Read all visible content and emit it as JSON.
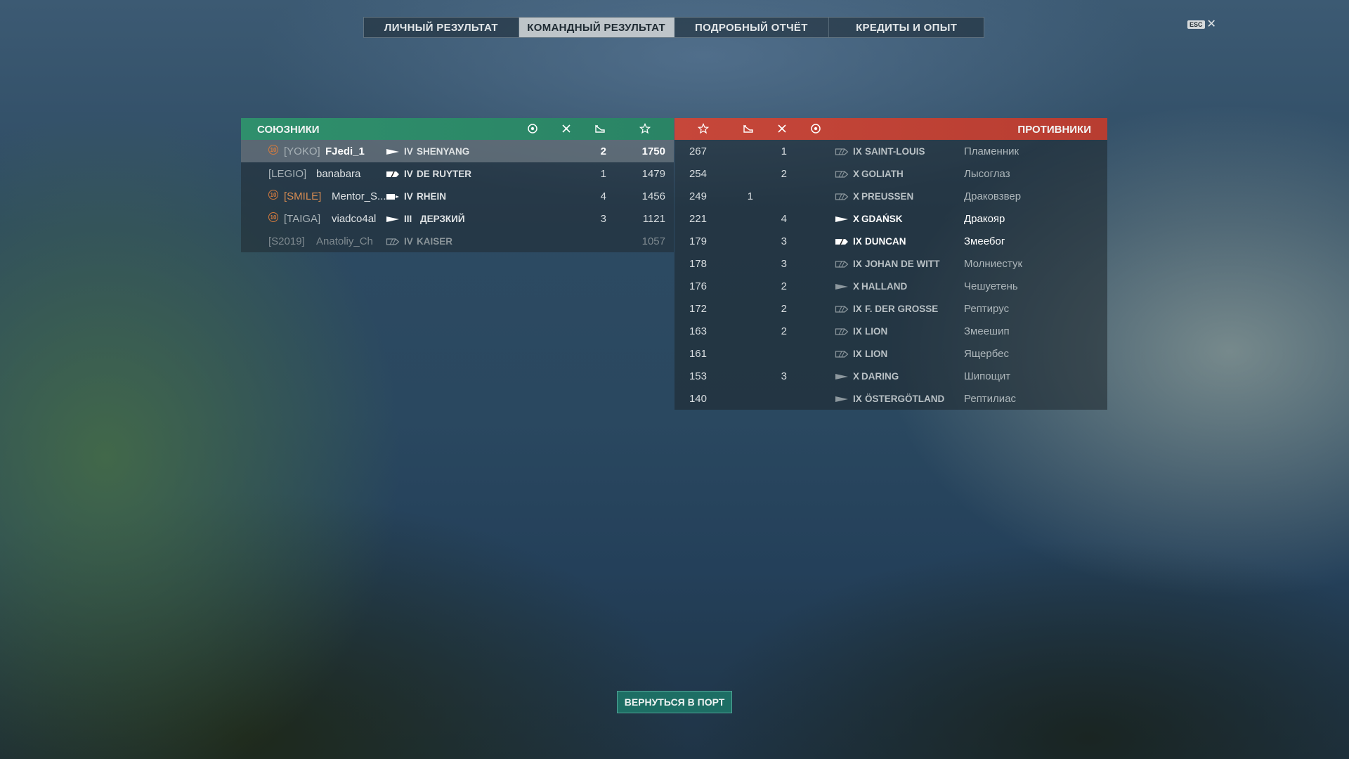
{
  "tabs": [
    "ЛИЧНЫЙ РЕЗУЛЬТАТ",
    "КОМАНДНЫЙ РЕЗУЛЬТАТ",
    "ПОДРОБНЫЙ ОТЧЁТ",
    "КРЕДИТЫ И ОПЫТ"
  ],
  "active_tab": 1,
  "esc_label": "ESC",
  "close_glyph": "✕",
  "allies": {
    "title": "СОЮЗНИКИ",
    "header_icons": [
      "achievement-icon",
      "frags-icon",
      "planes-icon",
      "star-icon"
    ],
    "rows": [
      {
        "badge": "10",
        "clan": "[YOKO]",
        "name": "FJedi_1",
        "tier": "IV",
        "ship": "SHENYANG",
        "ship_type": "destroyer",
        "kills": "2",
        "score": "1750",
        "highlight": true,
        "dim": false,
        "clan_color": "#a8b2b7"
      },
      {
        "badge": "",
        "clan": "[LEGIO]",
        "name": "banabara",
        "tier": "IV",
        "ship": "DE RUYTER",
        "ship_type": "cruiser",
        "kills": "1",
        "score": "1479",
        "highlight": false,
        "dim": false,
        "clan_color": "#a8b2b7"
      },
      {
        "badge": "10",
        "clan": "[SMILE]",
        "name": "Mentor_S...",
        "tier": "IV",
        "ship": "RHEIN",
        "ship_type": "carrier",
        "kills": "4",
        "score": "1456",
        "highlight": false,
        "dim": false,
        "clan_color": "#d98d52"
      },
      {
        "badge": "10",
        "clan": "[TAIGA]",
        "name": "viadco4al",
        "tier": "III",
        "ship": "ДЕРЗКИЙ",
        "ship_type": "destroyer",
        "kills": "3",
        "score": "1121",
        "highlight": false,
        "dim": false,
        "clan_color": "#a8b2b7"
      },
      {
        "badge": "",
        "clan": "[S2019]",
        "name": "Anatoliy_Ch",
        "tier": "IV",
        "ship": "KAISER",
        "ship_type": "battleship",
        "kills": "",
        "score": "1057",
        "highlight": false,
        "dim": true,
        "clan_color": "#7f8a90"
      }
    ]
  },
  "enemies": {
    "title": "ПРОТИВНИКИ",
    "header_icons": [
      "star-icon",
      "planes-icon",
      "frags-icon",
      "achievement-icon"
    ],
    "rows": [
      {
        "score": "267",
        "planes": "",
        "kills": "1",
        "tier": "IX",
        "ship": "SAINT-LOUIS",
        "ship_type": "battleship",
        "name": "Пламенник",
        "bright": false
      },
      {
        "score": "254",
        "planes": "",
        "kills": "2",
        "tier": "X",
        "ship": "GOLIATH",
        "ship_type": "battleship",
        "name": "Лысоглаз",
        "bright": false
      },
      {
        "score": "249",
        "planes": "1",
        "kills": "",
        "tier": "X",
        "ship": "PREUSSEN",
        "ship_type": "battleship",
        "name": "Драковзвер",
        "bright": false
      },
      {
        "score": "221",
        "planes": "",
        "kills": "4",
        "tier": "X",
        "ship": "GDAŃSK",
        "ship_type": "destroyer",
        "name": "Дракояр",
        "bright": true
      },
      {
        "score": "179",
        "planes": "",
        "kills": "3",
        "tier": "IX",
        "ship": "DUNCAN",
        "ship_type": "cruiser",
        "name": "Змеебог",
        "bright": true
      },
      {
        "score": "178",
        "planes": "",
        "kills": "3",
        "tier": "IX",
        "ship": "JOHAN DE WITT",
        "ship_type": "battleship",
        "name": "Молниестук",
        "bright": false
      },
      {
        "score": "176",
        "planes": "",
        "kills": "2",
        "tier": "X",
        "ship": "HALLAND",
        "ship_type": "destroyer",
        "name": "Чешуетень",
        "bright": false
      },
      {
        "score": "172",
        "planes": "",
        "kills": "2",
        "tier": "IX",
        "ship": "F. DER GROSSE",
        "ship_type": "battleship",
        "name": "Рептирус",
        "bright": false
      },
      {
        "score": "163",
        "planes": "",
        "kills": "2",
        "tier": "IX",
        "ship": "LION",
        "ship_type": "battleship",
        "name": "Змеешип",
        "bright": false
      },
      {
        "score": "161",
        "planes": "",
        "kills": "",
        "tier": "IX",
        "ship": "LION",
        "ship_type": "battleship",
        "name": "Ящербес",
        "bright": false
      },
      {
        "score": "153",
        "planes": "",
        "kills": "3",
        "tier": "X",
        "ship": "DARING",
        "ship_type": "destroyer",
        "name": "Шипощит",
        "bright": false
      },
      {
        "score": "140",
        "planes": "",
        "kills": "",
        "tier": "IX",
        "ship": "ÖSTERGÖTLAND",
        "ship_type": "destroyer",
        "name": "Рептилиас",
        "bright": false
      }
    ]
  },
  "back_button": "ВЕРНУТЬСЯ В ПОРТ"
}
